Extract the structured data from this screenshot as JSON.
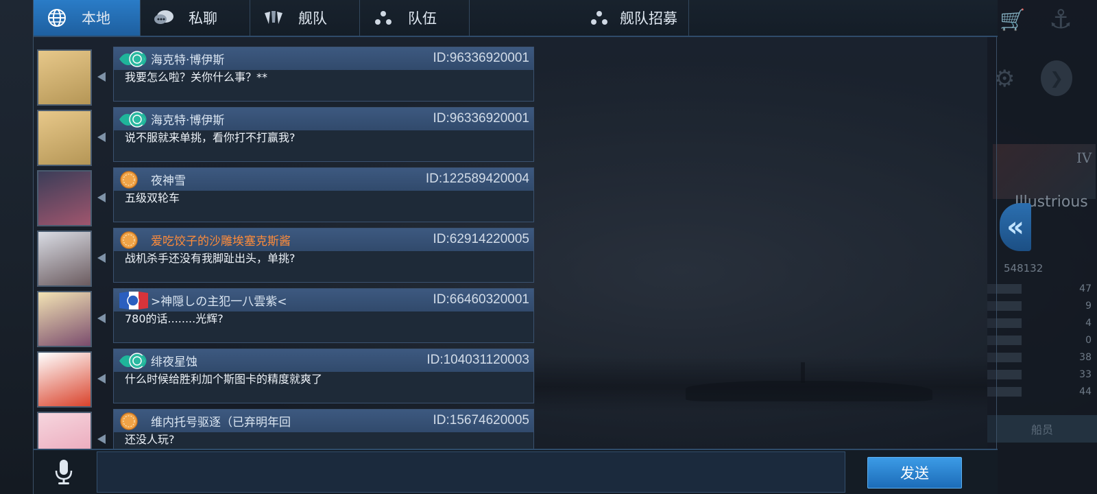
{
  "tabs": [
    {
      "label": "本地",
      "icon": "globe-icon",
      "active": true
    },
    {
      "label": "私聊",
      "icon": "chat-bubble-icon",
      "active": false
    },
    {
      "label": "舰队",
      "icon": "fleet-emblem-icon",
      "active": false
    },
    {
      "label": "队伍",
      "icon": "team-dots-icon",
      "active": false
    },
    {
      "label": "舰队招募",
      "icon": "team-dots-icon",
      "active": false
    }
  ],
  "messages": [
    {
      "name": "海克特·博伊斯",
      "id": "ID:96336920001",
      "text": "我要怎么啦？关你什么事？**",
      "badge": "wave-emblem",
      "name_color": "default",
      "avatar_colors": [
        "#e7c88a",
        "#b59656"
      ]
    },
    {
      "name": "海克特·博伊斯",
      "id": "ID:96336920001",
      "text": "说不服就来单挑，看你打不打赢我?",
      "badge": "wave-emblem",
      "name_color": "default",
      "avatar_colors": [
        "#e7c88a",
        "#b59656"
      ]
    },
    {
      "name": "夜神雪",
      "id": "ID:122589420004",
      "text": "五级双轮车",
      "badge": "orange-coin",
      "name_color": "default",
      "avatar_colors": [
        "#3b3d58",
        "#a0566e"
      ]
    },
    {
      "name": "爱吃饺子的沙雕埃塞克斯酱",
      "id": "ID:62914220005",
      "text": "战机杀手还没有我脚趾出头，单挑?",
      "badge": "orange-coin",
      "name_color": "orange",
      "avatar_colors": [
        "#d9dce4",
        "#6b5b5f"
      ]
    },
    {
      "name": ">神隠しの主犯一八雲紫<",
      "id": "ID:66460320001",
      "text": "780的话........光辉?",
      "badge": "french-flag",
      "name_color": "default",
      "avatar_colors": [
        "#f2e3b4",
        "#7a4c6d"
      ]
    },
    {
      "name": "绯夜星蚀",
      "id": "ID:104031120003",
      "text": "什么时候给胜利加个斯图卡的精度就爽了",
      "badge": "wave-emblem",
      "name_color": "default",
      "avatar_colors": [
        "#ffffff",
        "#d9432c"
      ]
    },
    {
      "name": "维内托号驱逐（已弃明年回",
      "id": "ID:15674620005",
      "text": "还没人玩?",
      "badge": "orange-coin",
      "name_color": "default",
      "avatar_colors": [
        "#f6d6de",
        "#e9a0b5"
      ]
    }
  ],
  "input": {
    "placeholder": "",
    "value": ""
  },
  "send_label": "发送",
  "game_panel": {
    "roman": "IV",
    "ship_name": "Illustrious",
    "ship_id": "548132",
    "stats": [
      47,
      9,
      4,
      0,
      38,
      33,
      44
    ],
    "crew_label": "船员"
  },
  "colors": {
    "accent": "#2a7cc7",
    "orange_name": "#ff8c3a",
    "header_bar": "#3d5980"
  }
}
